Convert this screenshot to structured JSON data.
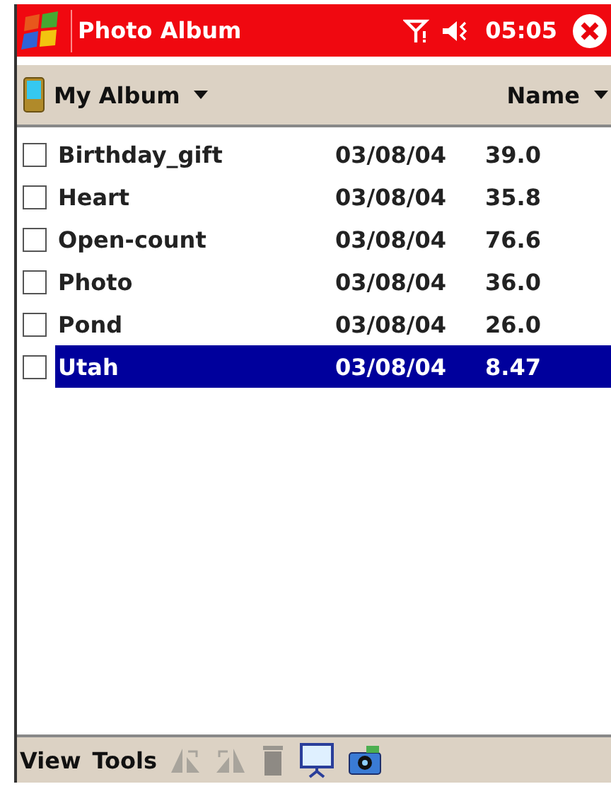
{
  "title_bar": {
    "title": "Photo Album",
    "time": "05:05"
  },
  "header": {
    "folder": "My Album",
    "sort": "Name"
  },
  "files": [
    {
      "name": "Birthday_gift",
      "date": "03/08/04",
      "size": "39.0",
      "checked": false,
      "selected": false
    },
    {
      "name": "Heart",
      "date": "03/08/04",
      "size": "35.8",
      "checked": false,
      "selected": false
    },
    {
      "name": "Open-count",
      "date": "03/08/04",
      "size": "76.6",
      "checked": false,
      "selected": false
    },
    {
      "name": "Photo",
      "date": "03/08/04",
      "size": "36.0",
      "checked": false,
      "selected": false
    },
    {
      "name": "Pond",
      "date": "03/08/04",
      "size": "26.0",
      "checked": false,
      "selected": false
    },
    {
      "name": "Utah",
      "date": "03/08/04",
      "size": "8.47",
      "checked": false,
      "selected": true
    }
  ],
  "menu_bar": {
    "menus": [
      "View",
      "Tools"
    ],
    "tools": [
      {
        "kind": "rotate-left",
        "disabled": true
      },
      {
        "kind": "rotate-right",
        "disabled": true
      },
      {
        "kind": "delete",
        "disabled": true
      },
      {
        "kind": "slideshow",
        "disabled": false
      },
      {
        "kind": "camera",
        "disabled": false
      }
    ]
  }
}
